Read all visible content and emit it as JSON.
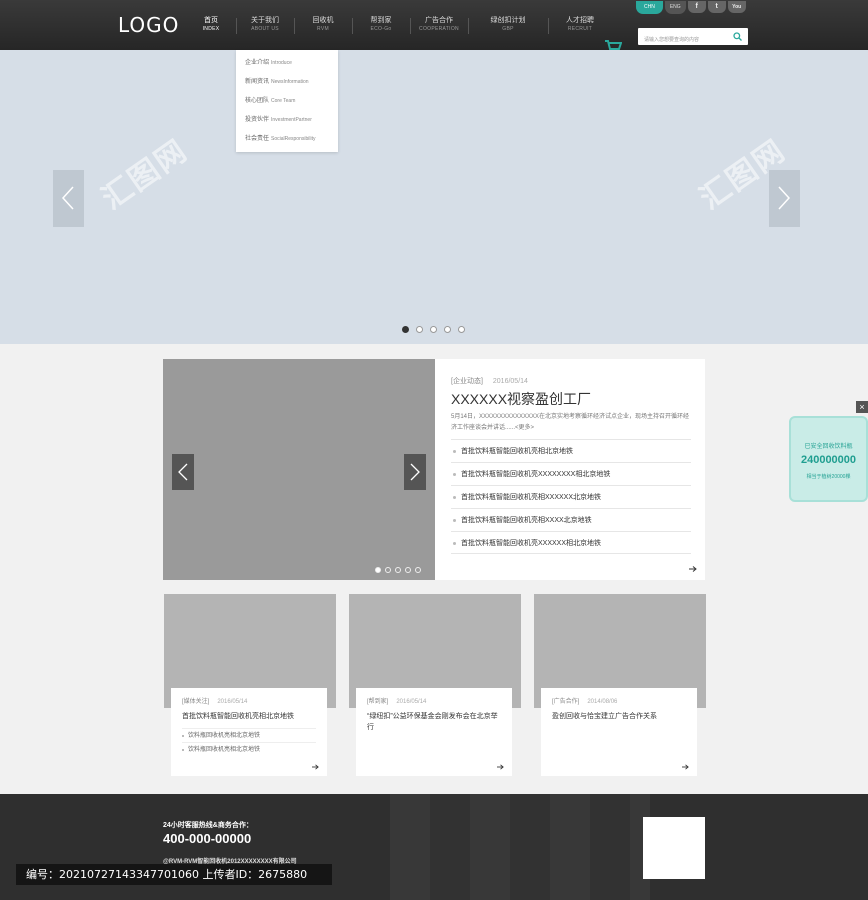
{
  "header": {
    "logo": "LOGO",
    "nav": [
      {
        "zh": "首页",
        "en": "INDEX"
      },
      {
        "zh": "关于我们",
        "en": "ABOUT US"
      },
      {
        "zh": "回收机",
        "en": "RVM"
      },
      {
        "zh": "帮到家",
        "en": "ECO-Go"
      },
      {
        "zh": "广告合作",
        "en": "COOPERATION"
      },
      {
        "zh": "绿创扣计划",
        "en": "GBP"
      },
      {
        "zh": "人才招聘",
        "en": "RECRUIT"
      }
    ],
    "languages": [
      "CHN",
      "ENG"
    ],
    "social": [
      "f",
      "t",
      "You"
    ],
    "search_placeholder": "请输入您想要查询的内容"
  },
  "dropdown": [
    {
      "zh": "企业介绍",
      "en": "Introduce"
    },
    {
      "zh": "新闻资讯",
      "en": "NewsInformation"
    },
    {
      "zh": "核心团队",
      "en": "Core Team"
    },
    {
      "zh": "投资伙伴",
      "en": "InvestmentPartner"
    },
    {
      "zh": "社会责任",
      "en": "SocialResponsibility"
    }
  ],
  "banner": {
    "watermark": "汇图网",
    "dots": 5,
    "active_dot": 0
  },
  "news": {
    "category": "[企业动态]",
    "date": "2016/05/14",
    "title": "XXXXXX视察盈创工厂",
    "desc": "5月14日，XXXXXXXXXXXXXXX在北京实地考察循环经济试点企业，现场主持召开循环经济工作座谈会并讲话......<更多>",
    "items": [
      "首批饮料瓶智能回收机亮相北京地铁",
      "首批饮料瓶智能回收机亮XXXXXXXX相北京地铁",
      "首批饮料瓶智能回收机亮相XXXXXX北京地铁",
      "首批饮料瓶智能回收机亮相XXXX北京地铁",
      "首批饮料瓶智能回收机亮XXXXXX相北京地铁"
    ],
    "dots": 5,
    "active_dot": 0
  },
  "float_widget": {
    "close": "×",
    "line1": "已安全回收饮料瓶",
    "number": "240000000",
    "line2": "相当于植树20000棵"
  },
  "cards": [
    {
      "category": "[媒体关注]",
      "date": "2016/05/14",
      "title": "首批饮料瓶智能回收机亮相北京地铁",
      "subs": [
        "饮料瓶回收机亮相北京地铁",
        "饮料瓶回收机亮相北京地铁"
      ]
    },
    {
      "category": "[帮到家]",
      "date": "2016/05/14",
      "title": "“绿纽扣”公益环保基金会刚发布会在北京举行",
      "subs": []
    },
    {
      "category": "[广告合作]",
      "date": "2014/08/06",
      "title": "盈创回收与恰宝建立广告合作关系",
      "subs": []
    }
  ],
  "footer": {
    "hotline_label": "24小时客服热线&商务合作：",
    "hotline": "400-000-00000",
    "copyright": "@RVM-RVM智能回收机2012XXXXXXXX有限公司"
  },
  "caption": "编号：20210727143347701060 上传者ID：2675880",
  "colors": {
    "accent": "#2aa89c",
    "header": "#2b2b2b",
    "banner": "#d6dee7"
  }
}
